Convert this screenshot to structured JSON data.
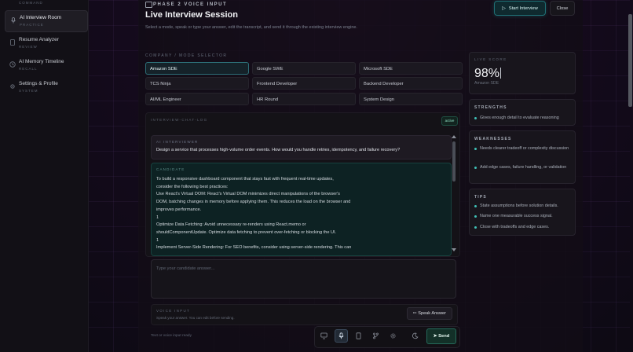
{
  "sidebar": {
    "items": [
      {
        "label": "",
        "sub": "COMMAND",
        "icon": "dashboard-icon"
      },
      {
        "label": "AI Interview Room",
        "sub": "PRACTICE",
        "icon": "mic-icon",
        "active": true
      },
      {
        "label": "Resume Analyzer",
        "sub": "REVIEW",
        "icon": "document-icon"
      },
      {
        "label": "AI Memory Timeline",
        "sub": "RECALL",
        "icon": "clock-icon"
      },
      {
        "label": "Settings & Profile",
        "sub": "SYSTEM",
        "icon": "gear-icon"
      }
    ]
  },
  "header": {
    "phase": "PHASE 2 VOICE INPUT",
    "title": "Live Interview Session",
    "subtitle": "Select a mode, speak or type your answer, edit the transcript, and send it through the existing interview engine.",
    "start_label": "Start Interview",
    "close_label": "Close"
  },
  "modes": {
    "label": "COMPANY / MODE SELECTOR",
    "items": [
      "Amazon SDE",
      "Google SWE",
      "Microsoft SDE",
      "TCS Ninja",
      "Frontend Developer",
      "Backend Developer",
      "AI/ML Engineer",
      "HR Round",
      "System Design"
    ],
    "active": "Amazon SDE"
  },
  "chat": {
    "log_label": "INTERVIEW-CHAT-LOG",
    "status": "active",
    "ai_role": "AI INTERVIEWER",
    "ai_text": "Design a service that processes high-volume order events. How would you handle retries, idempotency, and failure recovery?",
    "candidate_role": "CANDIDATE",
    "candidate_lines": [
      "To build a responsive dashboard component that stays fast with frequent real-time updates,",
      "consider the following best practices:",
      "Use React's Virtual DOM: React's Virtual DOM minimizes direct manipulations of the browser's",
      "DOM, batching changes in memory before applying them. This reduces the load on the browser and",
      "improves performance.",
      "1",
      "Optimize Data Fetching: Avoid unnecessary re-renders using React.memo or",
      "shouldComponentUpdate. Optimize data fetching to prevent over-fetching or blocking the UI.",
      "1",
      "Implement Server-Side Rendering: For SEO benefits, consider using server-side rendering. This can"
    ]
  },
  "answer": {
    "placeholder": "Type your candidate answer..."
  },
  "voice": {
    "label": "VOICE INPUT",
    "hint": "Speak your answer. You can edit before sending.",
    "speak_label": "Speak Answer"
  },
  "status_text": "Text or voice input ready",
  "toolbar": {
    "tools": [
      "monitor-icon",
      "mic-icon",
      "document-icon",
      "branch-icon",
      "gear-icon",
      "moon-icon"
    ],
    "send_label": "Send"
  },
  "score": {
    "label": "LIVE SCORE",
    "value": "98%",
    "sub": "Amazon SDE"
  },
  "strengths": {
    "title": "STRENGTHS",
    "items": [
      "Gives enough detail to evaluate reasoning"
    ]
  },
  "weaknesses": {
    "title": "WEAKNESSES",
    "items": [
      "Needs clearer tradeoff or complexity discussion",
      "Add edge cases, failure handling, or validation"
    ]
  },
  "tips": {
    "title": "TIPS",
    "items": [
      "State assumptions before solution details.",
      "Name one measurable success signal.",
      "Close with tradeoffs and edge cases."
    ]
  },
  "colors": {
    "accent": "#3fc0b6",
    "active_border": "#2d6f78",
    "background": "#0c0a12"
  }
}
